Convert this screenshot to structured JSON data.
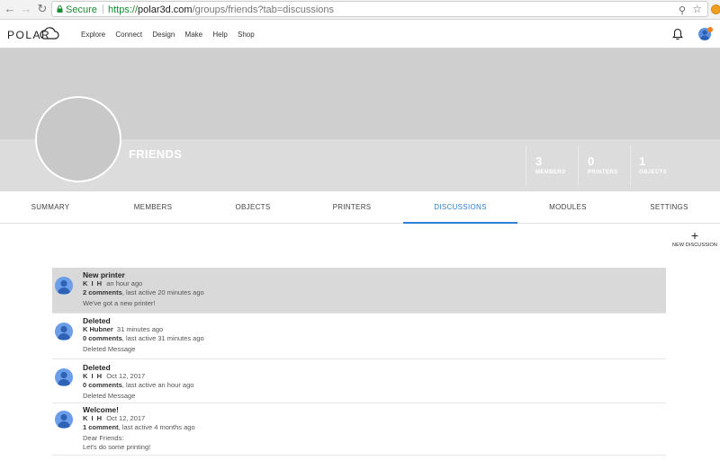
{
  "browser": {
    "secure_label": "Secure",
    "url_scheme": "https://",
    "url_host": "polar3d.com",
    "url_path": "/groups/friends?tab=discussions"
  },
  "header": {
    "logo": "POLAR",
    "menu": [
      "Explore",
      "Connect",
      "Design",
      "Make",
      "Help",
      "Shop"
    ]
  },
  "group": {
    "name": "FRIENDS",
    "stats": [
      {
        "value": "3",
        "label": "MEMBERS"
      },
      {
        "value": "0",
        "label": "PRINTERS"
      },
      {
        "value": "1",
        "label": "OBJECTS"
      }
    ]
  },
  "tabs": [
    {
      "label": "SUMMARY"
    },
    {
      "label": "MEMBERS"
    },
    {
      "label": "OBJECTS"
    },
    {
      "label": "PRINTERS"
    },
    {
      "label": "DISCUSSIONS",
      "active": true
    },
    {
      "label": "MODULES"
    },
    {
      "label": "SETTINGS"
    }
  ],
  "new_discussion": {
    "label": "NEW DISCUSSION"
  },
  "discussions": [
    {
      "title": "New printer",
      "author": "K I H",
      "time": "an hour ago",
      "count": "2 comments",
      "activity": ", last active 20 minutes ago",
      "body": [
        "We've got a new printer!"
      ]
    },
    {
      "title": "Deleted",
      "author": "K Hubner",
      "time": "31 minutes ago",
      "count": "0 comments",
      "activity": ", last active 31 minutes ago",
      "body": [
        "Deleted Message"
      ]
    },
    {
      "title": "Deleted",
      "author": "K I H",
      "time": "Oct 12, 2017",
      "count": "0 comments",
      "activity": ", last active an hour ago",
      "body": [
        "Deleted Message"
      ]
    },
    {
      "title": "Welcome!",
      "author": "K I H",
      "time": "Oct 12, 2017",
      "count": "1 comment",
      "activity": ", last active 4 months ago",
      "body": [
        "Dear Friends:",
        "Let's do some printing!"
      ]
    }
  ]
}
